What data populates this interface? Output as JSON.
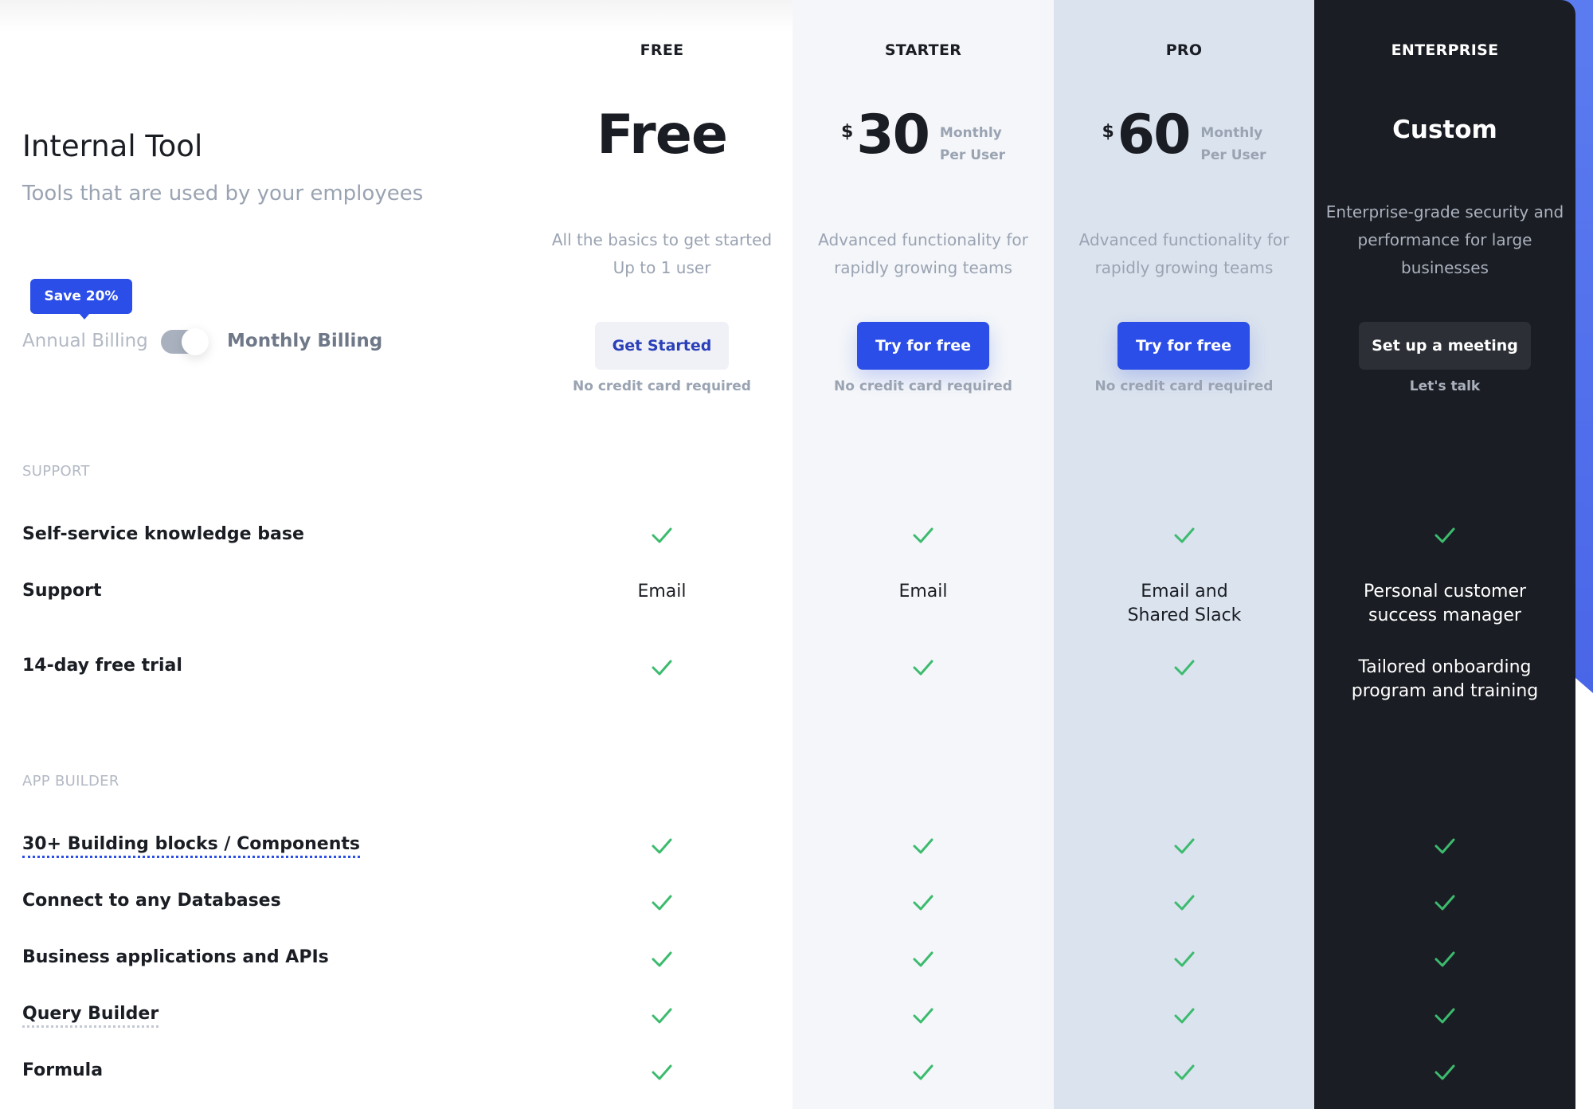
{
  "intro": {
    "title": "Internal Tool",
    "subtitle": "Tools that are used by your employees",
    "badge": "Save 20%",
    "annual_label": "Annual Billing",
    "monthly_label": "Monthly Billing",
    "billing_toggle_state": "monthly"
  },
  "plans": [
    {
      "name": "FREE",
      "price": "Free",
      "desc": [
        "All the basics to get started",
        "Up to 1 user"
      ],
      "button": "Get Started",
      "note": "No credit card required"
    },
    {
      "name": "STARTER",
      "currency": "$",
      "price": "30",
      "period": [
        "Monthly",
        "Per User"
      ],
      "desc": [
        "Advanced functionality for",
        "rapidly growing teams"
      ],
      "button": "Try for free",
      "note": "No credit card required"
    },
    {
      "name": "PRO",
      "currency": "$",
      "price": "60",
      "period": [
        "Monthly",
        "Per User"
      ],
      "desc": [
        "Advanced functionality for",
        "rapidly growing teams"
      ],
      "button": "Try for free",
      "note": "No credit card required"
    },
    {
      "name": "ENTERPRISE",
      "price": "Custom",
      "desc": [
        "Enterprise-grade security and",
        "performance for large",
        "businesses"
      ],
      "button": "Set up a meeting",
      "note": "Let's talk"
    }
  ],
  "sections": [
    {
      "title": "SUPPORT",
      "rows": [
        {
          "label": "Self-service knowledge base",
          "values": [
            "check",
            "check",
            "check",
            "check"
          ]
        },
        {
          "label": "Support",
          "values": [
            [
              "Email"
            ],
            [
              "Email"
            ],
            [
              "Email and",
              "Shared Slack"
            ],
            [
              "Personal customer",
              "success manager"
            ]
          ]
        },
        {
          "label": "14-day free trial",
          "values": [
            "check",
            "check",
            "check",
            [
              "Tailored onboarding",
              "program and training"
            ]
          ]
        }
      ]
    },
    {
      "title": "APP BUILDER",
      "rows": [
        {
          "label": "30+ Building blocks / Components",
          "values": [
            "check",
            "check",
            "check",
            "check"
          ]
        },
        {
          "label": "Connect to any Databases",
          "values": [
            "check",
            "check",
            "check",
            "check"
          ]
        },
        {
          "label": "Business applications and APIs",
          "values": [
            "check",
            "check",
            "check",
            "check"
          ]
        },
        {
          "label": "Query Builder",
          "values": [
            "check",
            "check",
            "check",
            "check"
          ]
        },
        {
          "label": "Formula",
          "values": [
            "check",
            "check",
            "check",
            "check"
          ]
        }
      ]
    }
  ],
  "colors": {
    "accent": "#2b4de8",
    "check": "#3cbb6e",
    "enterprise_bg": "#1a1d23",
    "pro_bg": "#dbe3ee",
    "starter_bg": "#f4f6f9"
  }
}
